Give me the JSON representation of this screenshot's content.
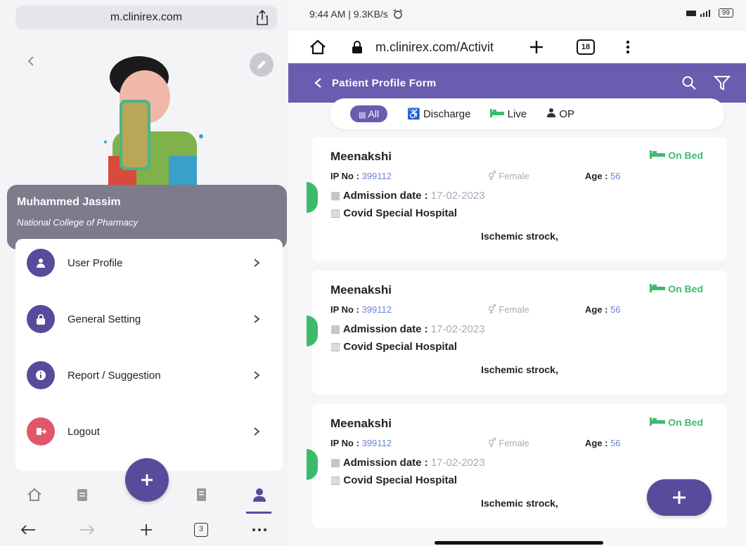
{
  "left": {
    "browser_url": "m.clinirex.com",
    "profile": {
      "name": "Muhammed Jassim",
      "college": "National College of Pharmacy"
    },
    "menu": [
      {
        "label": "User Profile",
        "icon": "user-icon",
        "color": "#5a4a9c"
      },
      {
        "label": "General Setting",
        "icon": "lock-icon",
        "color": "#5a4a9c"
      },
      {
        "label": "Report / Suggestion",
        "icon": "info-icon",
        "color": "#5a4a9c"
      },
      {
        "label": "Logout",
        "icon": "logout-icon",
        "color": "#e0576a"
      }
    ],
    "nav": [
      "home-icon",
      "clipboard-icon",
      "plus-icon",
      "document-icon",
      "person-icon"
    ],
    "browser_nav": {
      "tabs_count": "3"
    }
  },
  "right": {
    "status": {
      "time": "9:44 AM | 9.3KB/s",
      "battery": "99"
    },
    "chrome": {
      "url": "m.clinirex.com/Activit",
      "tabs": "18"
    },
    "appbar": {
      "title": "Patient Profile Form"
    },
    "filters": [
      {
        "label": "All",
        "icon": "list-icon"
      },
      {
        "label": "Discharge",
        "icon": "wheelchair-icon"
      },
      {
        "label": "Live",
        "icon": "bed-icon"
      },
      {
        "label": "OP",
        "icon": "doctor-icon"
      }
    ],
    "patients": [
      {
        "name": "Meenakshi",
        "status": "On Bed",
        "ip_label": "IP No :",
        "ip": "399112",
        "gender": "Female",
        "age_label": "Age :",
        "age": "56",
        "adm_label": "Admission date :",
        "adm": "17-02-2023",
        "hospital": "Covid Special Hospital",
        "diagnosis": "Ischemic strock,"
      },
      {
        "name": "Meenakshi",
        "status": "On Bed",
        "ip_label": "IP No :",
        "ip": "399112",
        "gender": "Female",
        "age_label": "Age :",
        "age": "56",
        "adm_label": "Admission date :",
        "adm": "17-02-2023",
        "hospital": "Covid Special Hospital",
        "diagnosis": "Ischemic strock,"
      },
      {
        "name": "Meenakshi",
        "status": "On Bed",
        "ip_label": "IP No :",
        "ip": "399112",
        "gender": "Female",
        "age_label": "Age :",
        "age": "56",
        "adm_label": "Admission date :",
        "adm": "17-02-2023",
        "hospital": "Covid Special Hospital",
        "diagnosis": "Ischemic strock,"
      }
    ]
  },
  "colors": {
    "accent": "#6a5cae",
    "green": "#3dbb6d",
    "logout": "#e0576a"
  }
}
